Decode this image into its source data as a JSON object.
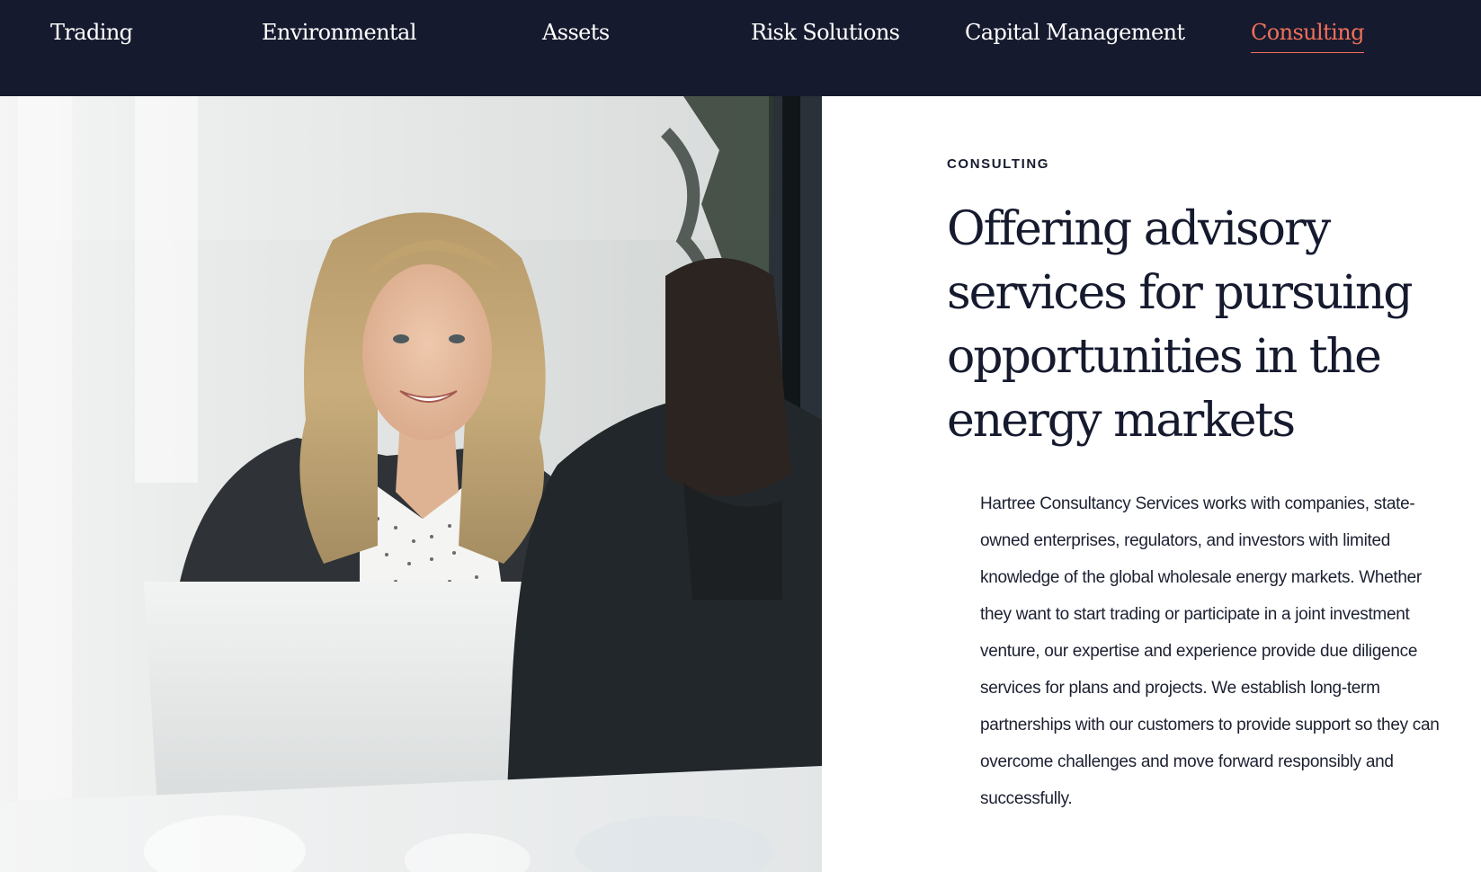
{
  "nav": {
    "items": [
      {
        "label": "Trading",
        "active": false
      },
      {
        "label": "Environmental",
        "active": false
      },
      {
        "label": "Assets",
        "active": false
      },
      {
        "label": "Risk Solutions",
        "active": false
      },
      {
        "label": "Capital Management",
        "active": false
      },
      {
        "label": "Consulting",
        "active": true
      }
    ]
  },
  "hero": {
    "image_subject": "woman-smiling-at-laptop-in-meeting"
  },
  "content": {
    "eyebrow": "CONSULTING",
    "headline": "Offering advisory services for pursuing opportunities in the energy markets",
    "body": "Hartree Consultancy Services works with companies, state-owned enterprises, regulators, and investors with limited knowledge of the global wholesale energy markets. Whether they want to start trading or participate in a joint investment venture, our expertise and experience provide due diligence services for plans and projects. We establish long-term partnerships with our customers to provide support so they can overcome challenges and move forward responsibly and successfully."
  },
  "colors": {
    "nav_bg": "#161a2e",
    "nav_text": "#ffffff",
    "accent": "#f0705a",
    "text_dark": "#161a2e"
  }
}
